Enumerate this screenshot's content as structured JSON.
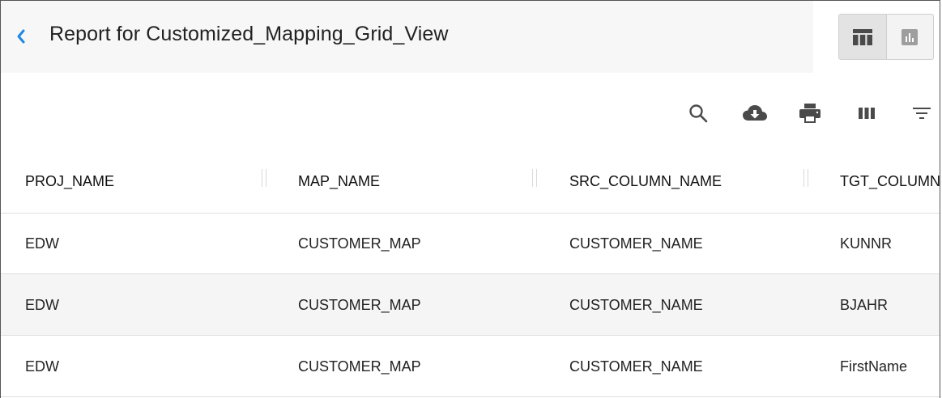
{
  "header": {
    "title": "Report for Customized_Mapping_Grid_View",
    "view_options": [
      "grid-view-icon",
      "chart-view-icon"
    ]
  },
  "toolbar": {
    "icons": [
      "search-icon",
      "cloud-download-icon",
      "print-icon",
      "columns-icon",
      "filter-icon"
    ]
  },
  "table": {
    "columns": [
      "PROJ_NAME",
      "MAP_NAME",
      "SRC_COLUMN_NAME",
      "TGT_COLUMN"
    ],
    "rows": [
      [
        "EDW",
        "CUSTOMER_MAP",
        "CUSTOMER_NAME",
        "KUNNR"
      ],
      [
        "EDW",
        "CUSTOMER_MAP",
        "CUSTOMER_NAME",
        "BJAHR"
      ],
      [
        "EDW",
        "CUSTOMER_MAP",
        "CUSTOMER_NAME",
        "FirstName"
      ]
    ]
  },
  "colors": {
    "accent": "#1e88e5",
    "icon": "#4a4a4a",
    "header_bg": "#f7f7f7",
    "alt_row_bg": "#f5f5f5"
  }
}
